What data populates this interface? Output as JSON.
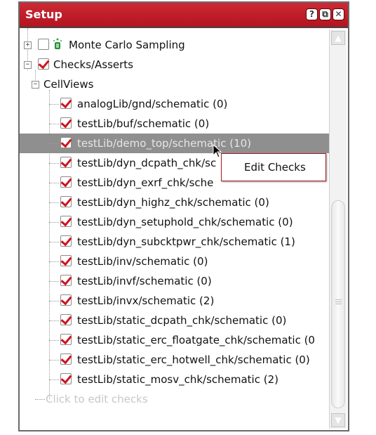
{
  "window": {
    "title": "Setup",
    "buttons": {
      "help": "?",
      "float": "⧉",
      "close": "✕"
    }
  },
  "tree": {
    "monte_carlo": {
      "label": "Monte Carlo Sampling",
      "expander": "+",
      "checked": false
    },
    "checks": {
      "label": "Checks/Asserts",
      "expander": "−",
      "checked": true
    },
    "cellviews": {
      "label": "CellViews",
      "expander": "−"
    },
    "items": [
      {
        "label": "analogLib/gnd/schematic (0)",
        "checked": true
      },
      {
        "label": "testLib/buf/schematic (0)",
        "checked": true
      },
      {
        "label": "testLib/demo_top/schematic (10)",
        "checked": true,
        "selected": true
      },
      {
        "label": "testLib/dyn_dcpath_chk/sc",
        "checked": true
      },
      {
        "label": "testLib/dyn_exrf_chk/sche",
        "checked": true
      },
      {
        "label": "testLib/dyn_highz_chk/schematic (0)",
        "checked": true
      },
      {
        "label": "testLib/dyn_setuphold_chk/schematic (0)",
        "checked": true
      },
      {
        "label": "testLib/dyn_subcktpwr_chk/schematic (1)",
        "checked": true
      },
      {
        "label": "testLib/inv/schematic (0)",
        "checked": true
      },
      {
        "label": "testLib/invf/schematic (0)",
        "checked": true
      },
      {
        "label": "testLib/invx/schematic (2)",
        "checked": true
      },
      {
        "label": "testLib/static_dcpath_chk/schematic (0)",
        "checked": true
      },
      {
        "label": "testLib/static_erc_floatgate_chk/schematic (0",
        "checked": true
      },
      {
        "label": "testLib/static_erc_hotwell_chk/schematic (0)",
        "checked": true
      },
      {
        "label": "testLib/static_mosv_chk/schematic (2)",
        "checked": true
      }
    ],
    "hint": "Click to edit checks"
  },
  "context_menu": {
    "items": [
      "Edit Checks"
    ]
  },
  "scrollbar": {
    "up": "▲",
    "down": "▼"
  },
  "colors": {
    "title_bar": "#c21d28",
    "check_mark": "#d0121c",
    "selection": "#8f8f8f"
  }
}
